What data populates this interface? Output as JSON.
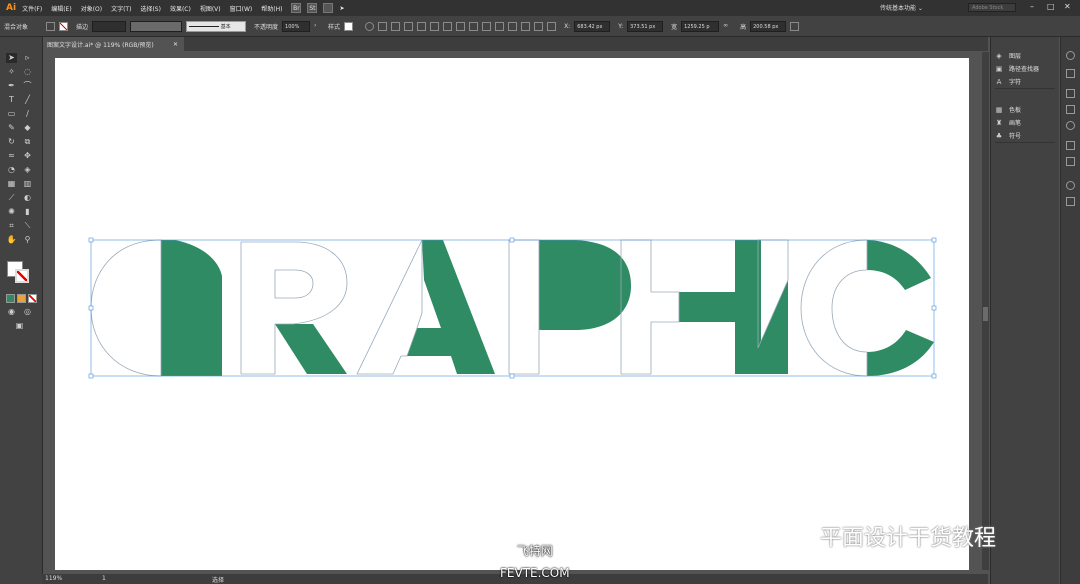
{
  "app": {
    "logo": "Ai"
  },
  "menu": [
    "文件(F)",
    "编辑(E)",
    "对象(O)",
    "文字(T)",
    "选择(S)",
    "效果(C)",
    "视图(V)",
    "窗口(W)",
    "帮助(H)"
  ],
  "menu_icons": [
    "Br",
    "St"
  ],
  "workspace_label": "传统基本功能 ⌄",
  "search_placeholder": "Adobe Stock",
  "window_controls": [
    "–",
    "□",
    "✕"
  ],
  "control": {
    "mixed_objects": "混合对象",
    "stroke_label": "描边",
    "stroke_style": "基本",
    "opacity_label": "不透明度",
    "opacity_value": "100%",
    "style_label": "样式",
    "x_value": "683.42 px",
    "y_value": "373.51 px",
    "w_label": "宽",
    "w_value": "1259.25 p",
    "h_label": "高",
    "h_value": "200.58 px"
  },
  "document_tab": {
    "title": "图案文字设计.ai* @ 119% (RGB/预览)",
    "close": "✕"
  },
  "panels": {
    "group1": [
      "图层",
      "路径查找器",
      "字符"
    ],
    "group2": [
      "色板",
      "画笔",
      "符号"
    ]
  },
  "status": {
    "zoom": "119%",
    "page": "1",
    "tool": "选择"
  },
  "artwork": {
    "word": "GRAPHIC",
    "fill_color": "#2e8b63",
    "outline_color": "#9aaab8"
  },
  "watermarks": {
    "wechat": "平面设计干货教程",
    "site_cn": "飞特网",
    "site_en": "FEVTE.COM"
  }
}
